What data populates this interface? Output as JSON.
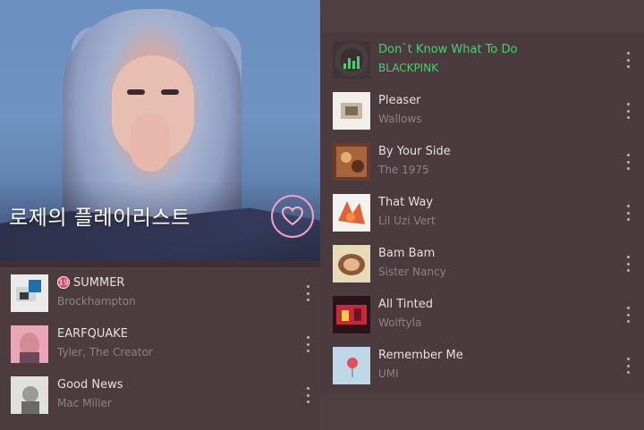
{
  "playlist": {
    "title": "로제의 플레이리스트",
    "accent_color": "#3ed66a",
    "heart_color": "#f0a0c0"
  },
  "left_tracks": [
    {
      "title": "SUMMER",
      "artist": "Brockhampton",
      "explicit_badge": "19"
    },
    {
      "title": "EARFQUAKE",
      "artist": "Tyler, The Creator"
    },
    {
      "title": "Good News",
      "artist": "Mac Miller"
    }
  ],
  "right_tracks": [
    {
      "title": "Don`t Know What To Do",
      "artist": "BLACKPINK",
      "now_playing": true
    },
    {
      "title": "Pleaser",
      "artist": "Wallows"
    },
    {
      "title": "By Your Side",
      "artist": "The 1975"
    },
    {
      "title": "That Way",
      "artist": "Lil Uzi Vert"
    },
    {
      "title": "Bam Bam",
      "artist": "Sister Nancy"
    },
    {
      "title": "All Tinted",
      "artist": "Wolftyla"
    },
    {
      "title": "Remember Me",
      "artist": "UMI"
    }
  ],
  "icons": {
    "heart": "heart-icon",
    "more": "more-vertical-icon",
    "now_playing": "equalizer-icon",
    "explicit": "age-19-badge"
  }
}
